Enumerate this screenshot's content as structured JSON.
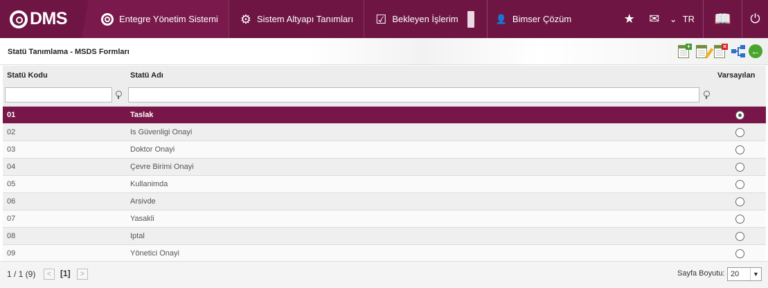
{
  "app": {
    "logo": "DMS"
  },
  "topnav": {
    "items": [
      {
        "label": "Entegre Yönetim Sistemi",
        "icon": "q-circle-icon"
      },
      {
        "label": "Sistem Altyapı Tanımları",
        "icon": "gear-icon"
      },
      {
        "label": "Bekleyen İşlerim",
        "icon": "clipboard-check-icon"
      }
    ],
    "user": "Bimser Çözüm",
    "language": "TR"
  },
  "page": {
    "title": "Statü Tanımlama - MSDS Formları"
  },
  "grid": {
    "columns": {
      "code": "Statü Kodu",
      "name": "Statü Adı",
      "default": "Varsayılan"
    },
    "filters": {
      "code": "",
      "name": ""
    },
    "rows": [
      {
        "code": "01",
        "name": "Taslak",
        "default": true,
        "selected": true
      },
      {
        "code": "02",
        "name": "Is Güvenligi Onayi",
        "default": false
      },
      {
        "code": "03",
        "name": "Doktor Onayi",
        "default": false
      },
      {
        "code": "04",
        "name": "Çevre Birimi Onayi",
        "default": false
      },
      {
        "code": "05",
        "name": "Kullanimda",
        "default": false
      },
      {
        "code": "06",
        "name": "Arsivde",
        "default": false
      },
      {
        "code": "07",
        "name": "Yasakli",
        "default": false
      },
      {
        "code": "08",
        "name": "Iptal",
        "default": false
      },
      {
        "code": "09",
        "name": "Yönetici Onayi",
        "default": false
      }
    ]
  },
  "pager": {
    "info": "1 / 1 (9)",
    "current": "[1]",
    "prev": "<",
    "next": ">",
    "size_label": "Sayfa Boyutu:",
    "size_value": "20"
  },
  "colors": {
    "brand": "#6e1543",
    "selected_row": "#78164a"
  }
}
